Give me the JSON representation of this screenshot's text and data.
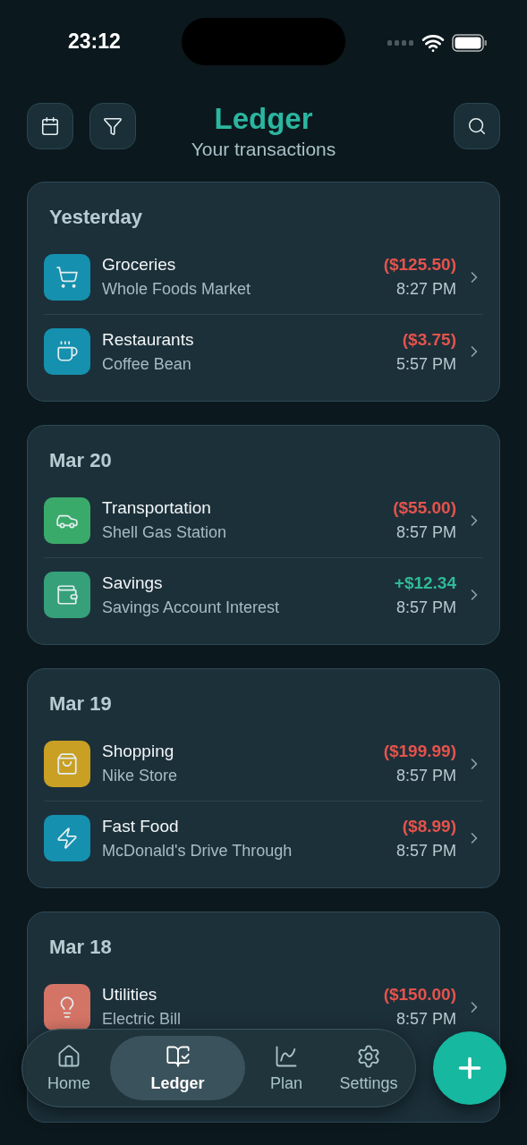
{
  "status_bar": {
    "time": "23:12"
  },
  "header": {
    "title": "Ledger",
    "subtitle": "Your transactions"
  },
  "groups": [
    {
      "date": "Yesterday",
      "transactions": [
        {
          "kind": "groceries",
          "color": "#1590ae",
          "name": "Groceries",
          "merchant": "Whole Foods Market",
          "amount": "($125.50)",
          "income": false,
          "time": "8:27 PM"
        },
        {
          "kind": "dining",
          "color": "#1590ae",
          "name": "Restaurants",
          "merchant": "Coffee Bean",
          "amount": "($3.75)",
          "income": false,
          "time": "5:57 PM"
        }
      ]
    },
    {
      "date": "Mar 20",
      "transactions": [
        {
          "kind": "transport",
          "color": "#3aaa6a",
          "name": "Transportation",
          "merchant": "Shell Gas Station",
          "amount": "($55.00)",
          "income": false,
          "time": "8:57 PM"
        },
        {
          "kind": "savings",
          "color": "#35a079",
          "name": "Savings",
          "merchant": "Savings Account Interest",
          "amount": "+$12.34",
          "income": true,
          "time": "8:57 PM"
        }
      ]
    },
    {
      "date": "Mar 19",
      "transactions": [
        {
          "kind": "shopping",
          "color": "#c9a024",
          "name": "Shopping",
          "merchant": "Nike Store",
          "amount": "($199.99)",
          "income": false,
          "time": "8:57 PM"
        },
        {
          "kind": "fastfood",
          "color": "#1590ae",
          "name": "Fast Food",
          "merchant": "McDonald's Drive Through",
          "amount": "($8.99)",
          "income": false,
          "time": "8:57 PM"
        }
      ]
    },
    {
      "date": "Mar 18",
      "transactions": [
        {
          "kind": "utilities",
          "color": "#d47466",
          "name": "Utilities",
          "merchant": "Electric Bill",
          "amount": "($150.00)",
          "income": false,
          "time": "8:57 PM"
        }
      ]
    }
  ],
  "tab_bar": [
    {
      "kind": "home",
      "label": "Home",
      "selected": false
    },
    {
      "kind": "ledger",
      "label": "Ledger",
      "selected": true
    },
    {
      "kind": "plan",
      "label": "Plan",
      "selected": false
    },
    {
      "kind": "settings",
      "label": "Settings",
      "selected": false
    }
  ]
}
